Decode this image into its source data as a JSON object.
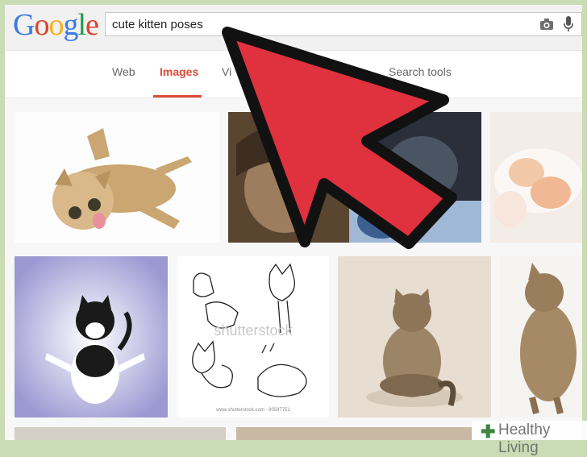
{
  "logo": {
    "letters": [
      "G",
      "o",
      "o",
      "g",
      "l",
      "e"
    ],
    "colors": [
      "#3b7ae6",
      "#d9432f",
      "#f1b51b",
      "#3b7ae6",
      "#1e9c49",
      "#d9432f"
    ]
  },
  "search": {
    "query": "cute kitten poses"
  },
  "icons": {
    "camera": "camera-icon",
    "microphone": "microphone-icon"
  },
  "tabs": [
    {
      "label": "Web",
      "active": false
    },
    {
      "label": "Images",
      "active": true
    },
    {
      "label": "Vi",
      "active": false
    },
    {
      "label": "Search tools",
      "active": false
    }
  ],
  "results": {
    "count_visible": 12,
    "watermark_text": "shutterstock",
    "stock_id": "www.shutterstock.com · 80547751"
  },
  "watermark": {
    "label": "Healthy Living"
  },
  "overlay": {
    "arrow_color": "#e0313f",
    "arrow_outline": "#111111"
  }
}
